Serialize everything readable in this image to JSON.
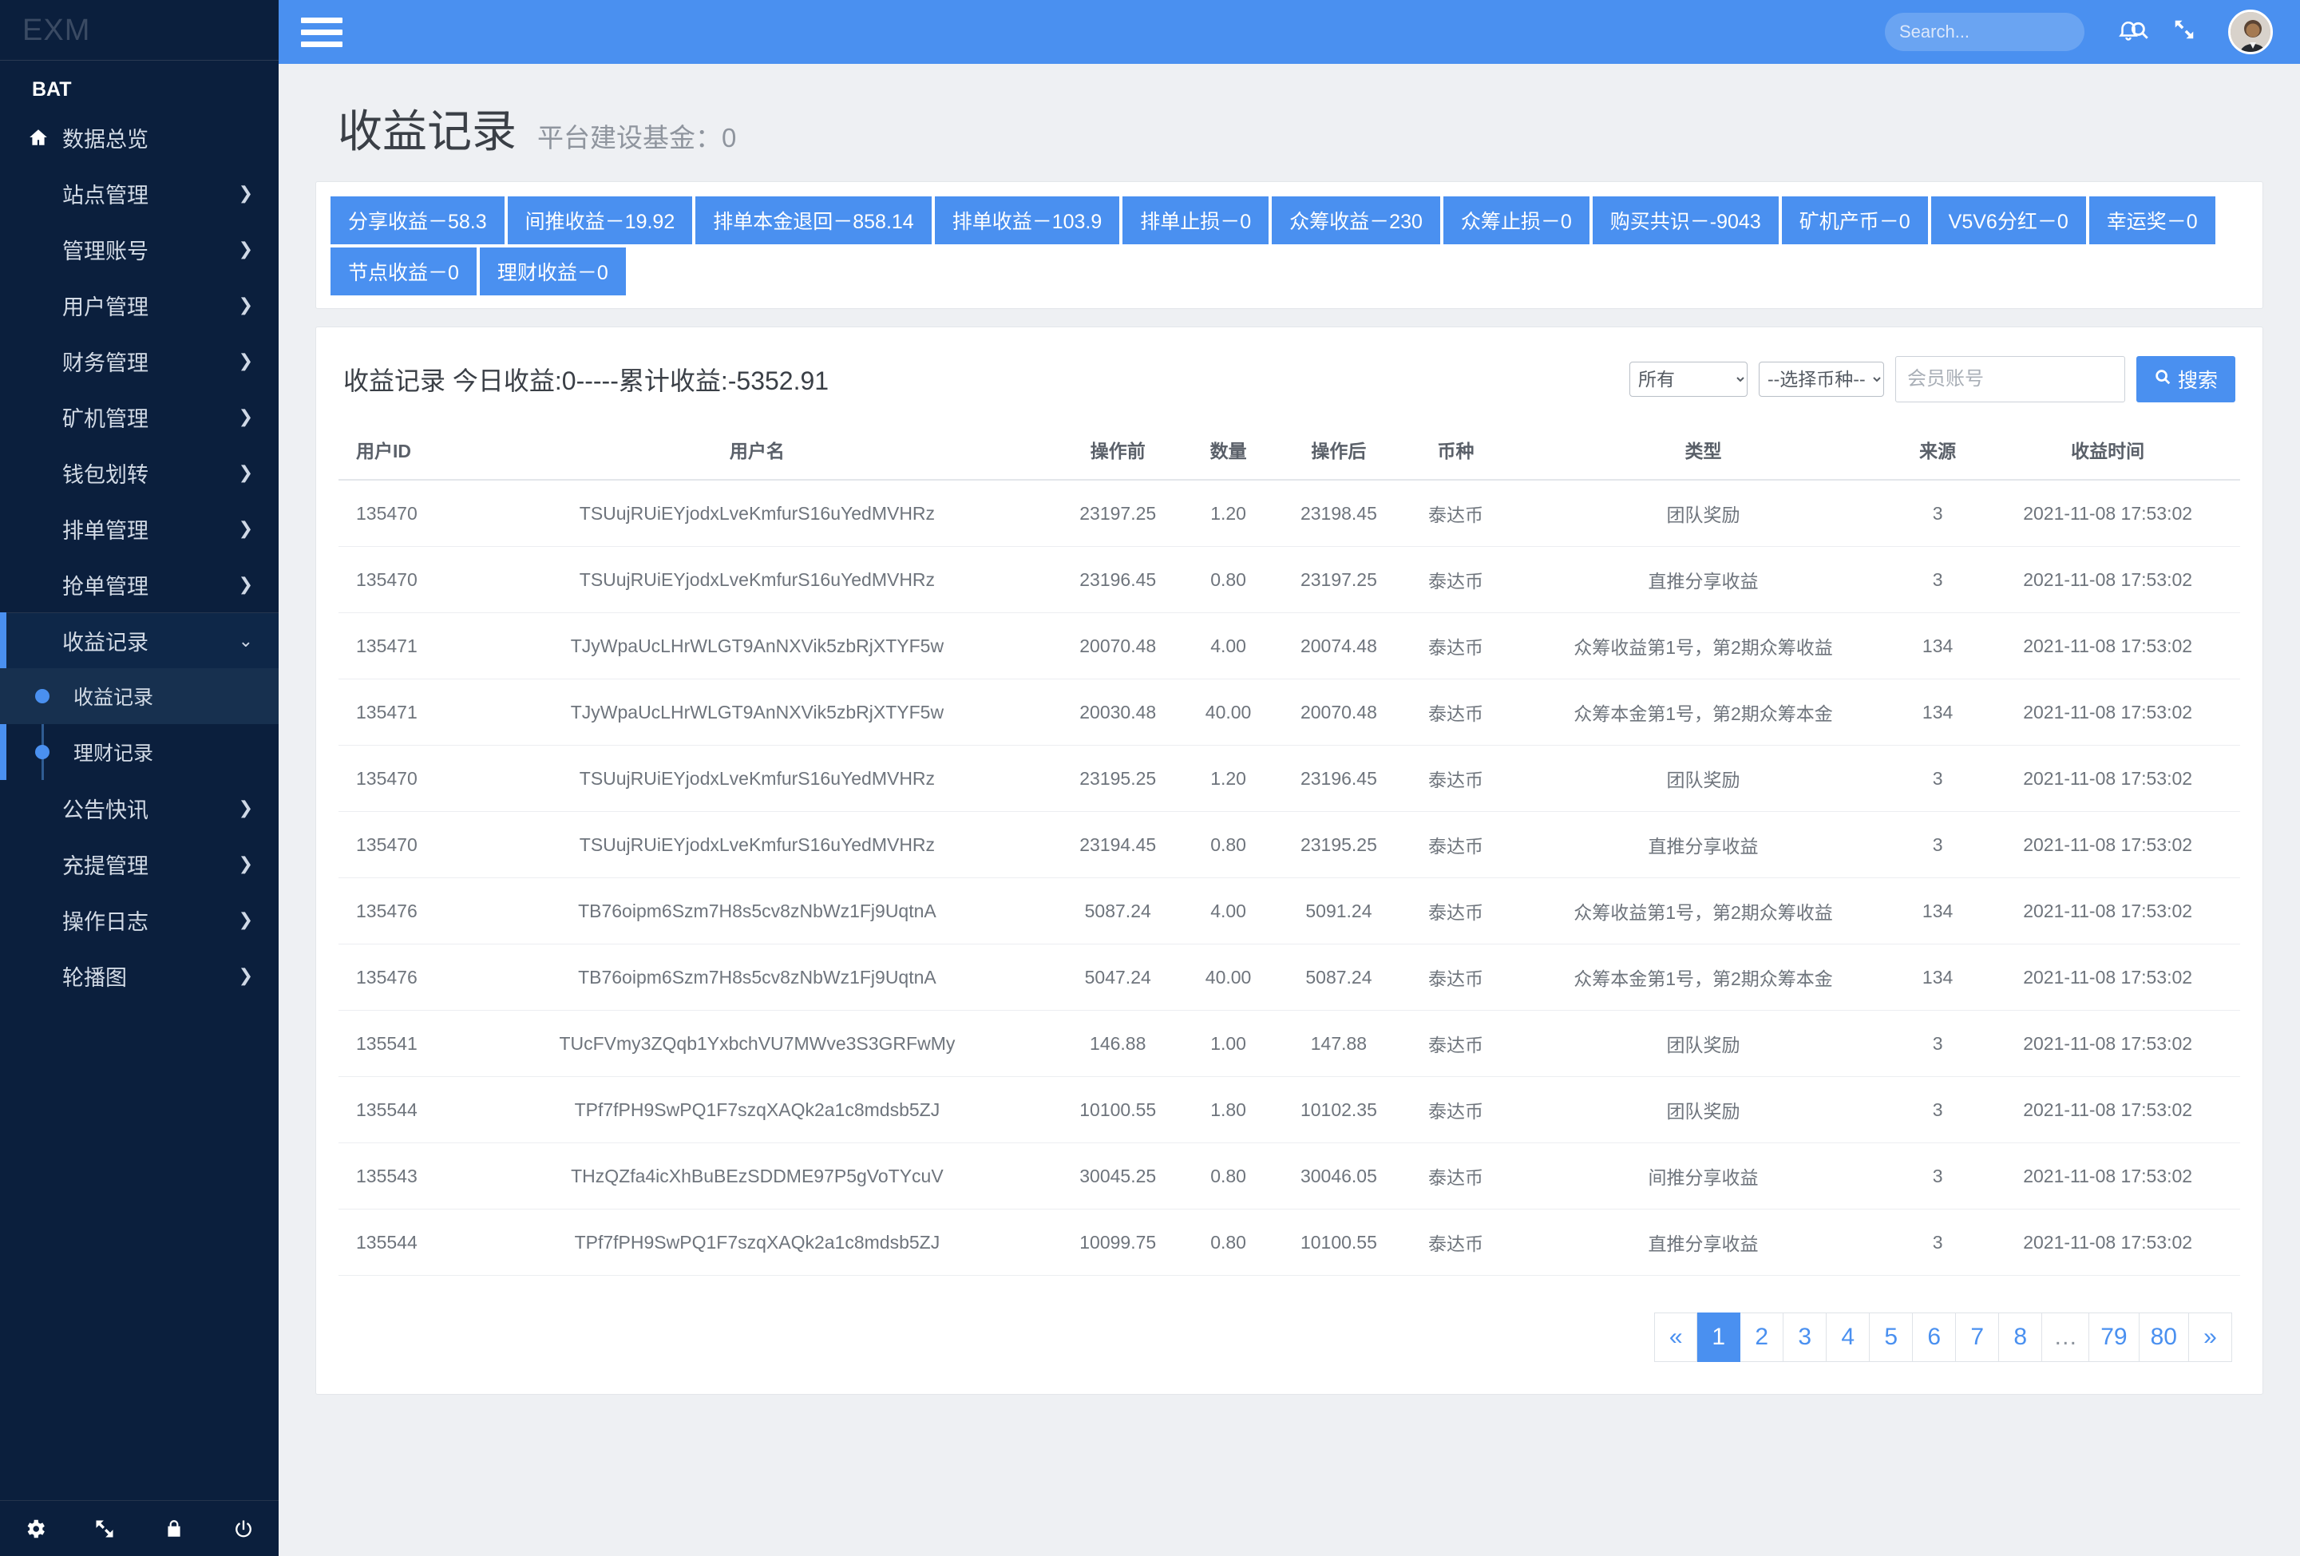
{
  "sidebar": {
    "brand": "EXM",
    "section_label": "BAT",
    "items": [
      {
        "label": "数据总览",
        "icon": "home-icon",
        "has_arrow": false
      },
      {
        "label": "站点管理",
        "icon": "",
        "has_arrow": true
      },
      {
        "label": "管理账号",
        "icon": "",
        "has_arrow": true
      },
      {
        "label": "用户管理",
        "icon": "",
        "has_arrow": true
      },
      {
        "label": "财务管理",
        "icon": "",
        "has_arrow": true
      },
      {
        "label": "矿机管理",
        "icon": "",
        "has_arrow": true
      },
      {
        "label": "钱包划转",
        "icon": "",
        "has_arrow": true
      },
      {
        "label": "排单管理",
        "icon": "",
        "has_arrow": true
      },
      {
        "label": "抢单管理",
        "icon": "",
        "has_arrow": true
      }
    ],
    "expanded_item": {
      "label": "收益记录",
      "arrow": "chevron-down-icon"
    },
    "submenu": [
      {
        "label": "收益记录",
        "active": true
      },
      {
        "label": "理财记录",
        "active": false
      }
    ],
    "items_after": [
      {
        "label": "公告快讯",
        "has_arrow": true
      },
      {
        "label": "充提管理",
        "has_arrow": true
      },
      {
        "label": "操作日志",
        "has_arrow": true
      },
      {
        "label": "轮播图",
        "has_arrow": true
      }
    ],
    "footer_icons": [
      "gear-icon",
      "expand-icon",
      "lock-icon",
      "power-icon"
    ]
  },
  "topbar": {
    "menu_toggle": "hamburger-icon",
    "search_placeholder": "Search...",
    "search_value": "",
    "search_icon": "search-icon",
    "bell_icon": "bell-icon",
    "fullscreen_icon": "fullscreen-icon",
    "avatar": "user-avatar"
  },
  "page": {
    "title": "收益记录",
    "subtitle": "平台建设基金：0"
  },
  "badges": [
    "分享收益－58.3",
    "间推收益－19.92",
    "排单本金退回－858.14",
    "排单收益－103.9",
    "排单止损－0",
    "众筹收益－230",
    "众筹止损－0",
    "购买共识－-9043",
    "矿机产币－0",
    "V5V6分红－0",
    "幸运奖－0",
    "节点收益－0",
    "理财收益－0"
  ],
  "filter": {
    "title": "收益记录 今日收益:0-----累计收益:-5352.91",
    "type_select": {
      "value": "所有",
      "options": [
        "所有"
      ]
    },
    "coin_select": {
      "value": "--选择币种--",
      "options": [
        "--选择币种--"
      ]
    },
    "account_placeholder": "会员账号",
    "account_value": "",
    "search_button": "搜索",
    "search_icon": "search-icon"
  },
  "table": {
    "columns": [
      "用户ID",
      "用户名",
      "操作前",
      "数量",
      "操作后",
      "币种",
      "类型",
      "来源",
      "收益时间"
    ],
    "rows": [
      [
        "135470",
        "TSUujRUiEYjodxLveKmfurS16uYedMVHRz",
        "23197.25",
        "1.20",
        "23198.45",
        "泰达币",
        "团队奖励",
        "3",
        "2021-11-08 17:53:02"
      ],
      [
        "135470",
        "TSUujRUiEYjodxLveKmfurS16uYedMVHRz",
        "23196.45",
        "0.80",
        "23197.25",
        "泰达币",
        "直推分享收益",
        "3",
        "2021-11-08 17:53:02"
      ],
      [
        "135471",
        "TJyWpaUcLHrWLGT9AnNXVik5zbRjXTYF5w",
        "20070.48",
        "4.00",
        "20074.48",
        "泰达币",
        "众筹收益第1号，第2期众筹收益",
        "134",
        "2021-11-08 17:53:02"
      ],
      [
        "135471",
        "TJyWpaUcLHrWLGT9AnNXVik5zbRjXTYF5w",
        "20030.48",
        "40.00",
        "20070.48",
        "泰达币",
        "众筹本金第1号，第2期众筹本金",
        "134",
        "2021-11-08 17:53:02"
      ],
      [
        "135470",
        "TSUujRUiEYjodxLveKmfurS16uYedMVHRz",
        "23195.25",
        "1.20",
        "23196.45",
        "泰达币",
        "团队奖励",
        "3",
        "2021-11-08 17:53:02"
      ],
      [
        "135470",
        "TSUujRUiEYjodxLveKmfurS16uYedMVHRz",
        "23194.45",
        "0.80",
        "23195.25",
        "泰达币",
        "直推分享收益",
        "3",
        "2021-11-08 17:53:02"
      ],
      [
        "135476",
        "TB76oipm6Szm7H8s5cv8zNbWz1Fj9UqtnA",
        "5087.24",
        "4.00",
        "5091.24",
        "泰达币",
        "众筹收益第1号，第2期众筹收益",
        "134",
        "2021-11-08 17:53:02"
      ],
      [
        "135476",
        "TB76oipm6Szm7H8s5cv8zNbWz1Fj9UqtnA",
        "5047.24",
        "40.00",
        "5087.24",
        "泰达币",
        "众筹本金第1号，第2期众筹本金",
        "134",
        "2021-11-08 17:53:02"
      ],
      [
        "135541",
        "TUcFVmy3ZQqb1YxbchVU7MWve3S3GRFwMy",
        "146.88",
        "1.00",
        "147.88",
        "泰达币",
        "团队奖励",
        "3",
        "2021-11-08 17:53:02"
      ],
      [
        "135544",
        "TPf7fPH9SwPQ1F7szqXAQk2a1c8mdsb5ZJ",
        "10100.55",
        "1.80",
        "10102.35",
        "泰达币",
        "团队奖励",
        "3",
        "2021-11-08 17:53:02"
      ],
      [
        "135543",
        "THzQZfa4icXhBuBEzSDDME97P5gVoTYcuV",
        "30045.25",
        "0.80",
        "30046.05",
        "泰达币",
        "间推分享收益",
        "3",
        "2021-11-08 17:53:02"
      ],
      [
        "135544",
        "TPf7fPH9SwPQ1F7szqXAQk2a1c8mdsb5ZJ",
        "10099.75",
        "0.80",
        "10100.55",
        "泰达币",
        "直推分享收益",
        "3",
        "2021-11-08 17:53:02"
      ]
    ]
  },
  "pagination": {
    "prev": "«",
    "next": "»",
    "pages": [
      "1",
      "2",
      "3",
      "4",
      "5",
      "6",
      "7",
      "8",
      "…",
      "79",
      "80"
    ],
    "active": "1"
  },
  "colors": {
    "accent": "#4a90f0",
    "sidebar_bg": "#0b1f3d",
    "page_bg": "#eef0f3"
  }
}
